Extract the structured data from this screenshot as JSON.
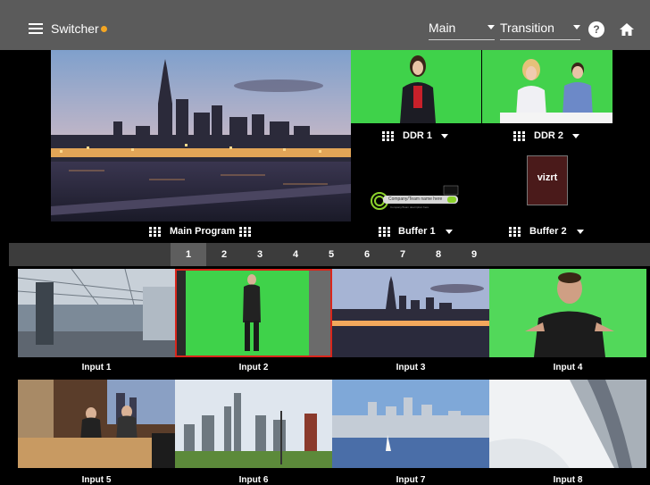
{
  "header": {
    "menu_icon": "hamburger-icon",
    "title": "Switcher",
    "status_color": "#f4a623",
    "main_select": "Main",
    "transition_select": "Transition",
    "help_label": "?",
    "help_icon": "help-icon",
    "home_icon": "home-icon"
  },
  "outputs": {
    "main_program_label": "Main Program",
    "ddr1_label": "DDR 1",
    "ddr2_label": "DDR 2",
    "buffer1_label": "Buffer 1",
    "buffer2_label": "Buffer 2",
    "buffer1_lowerthird_title": "Company/Team name here",
    "buffer1_lowerthird_sub": "Company/Team description here",
    "buffer2_logo_text": "vizrt"
  },
  "pages": {
    "numbers": [
      "1",
      "2",
      "3",
      "4",
      "5",
      "6",
      "7",
      "8",
      "9"
    ],
    "active": "1"
  },
  "inputs": {
    "labels": [
      "Input 1",
      "Input 2",
      "Input 3",
      "Input 4",
      "Input 5",
      "Input 6",
      "Input 7",
      "Input 8"
    ],
    "selected": "Input 2"
  },
  "colors": {
    "topbar": "#5b5b5b",
    "selected_outline": "#d9261c",
    "green_screen": "#3fd24a"
  }
}
